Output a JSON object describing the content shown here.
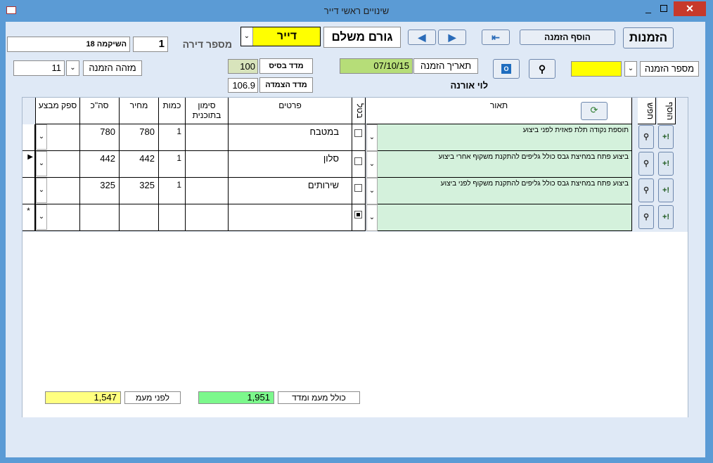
{
  "window": {
    "title": "שינויים ראשי דייר",
    "close": "✕",
    "minimize": "_"
  },
  "header": {
    "orders_btn": "הזמנות",
    "add_order_btn": "הוסף הזמנה",
    "payer_label": "גורם משלם",
    "payer_value": "דייר",
    "apartment_label": "מספר דירה",
    "apartment_value": "1",
    "address_value": "השיקמה 18",
    "order_number_label": "מספר הזמנה",
    "order_number_value": "",
    "order_id_label": "מזהה הזמנה",
    "order_id_value": "11",
    "order_date_label": "תאריך הזמנה",
    "order_date_value": "07/10/15",
    "base_index_label": "מדד בסיס",
    "base_index_value": "100",
    "linked_index_label": "מדד הצמדה",
    "linked_index_value": "106.9",
    "customer_name": "לוי אורנה"
  },
  "table": {
    "columns": {
      "add": "הוסף",
      "find": "חפש",
      "description": "תאור",
      "cancel": "בטל",
      "details": "פרטים",
      "plan_mark": "סימון בתוכנית",
      "quantity": "כמות",
      "price": "מחיר",
      "total": "סה\"כ",
      "supplier": "ספק מבצע"
    },
    "rows": [
      {
        "description": "תוספת נקודה תלת פאזית לפני ביצוע",
        "details": "במטבח",
        "plan_mark": "",
        "quantity": "1",
        "price": "780",
        "total": "780",
        "supplier": ""
      },
      {
        "description": "ביצוע פתח במחיצת גבס כולל גליפים להתקנת משקוף אחרי ביצוע",
        "details": "סלון",
        "plan_mark": "",
        "quantity": "1",
        "price": "442",
        "total": "442",
        "supplier": ""
      },
      {
        "description": "ביצוע פתח במחיצת גבס כולל גליפים להתקנת משקוף לפני ביצוע",
        "details": "שירותים",
        "plan_mark": "",
        "quantity": "1",
        "price": "325",
        "total": "325",
        "supplier": ""
      }
    ],
    "new_row_marker": "*",
    "current_row_marker": "▶"
  },
  "footer": {
    "total_with_vat_label": "כולל מעמ ומדד",
    "total_with_vat_value": "1,951",
    "before_vat_label": "לפני מעמ",
    "before_vat_value": "1,547"
  },
  "icons": {
    "add": "+!",
    "find": "⚲",
    "dropdown": "⌄"
  }
}
